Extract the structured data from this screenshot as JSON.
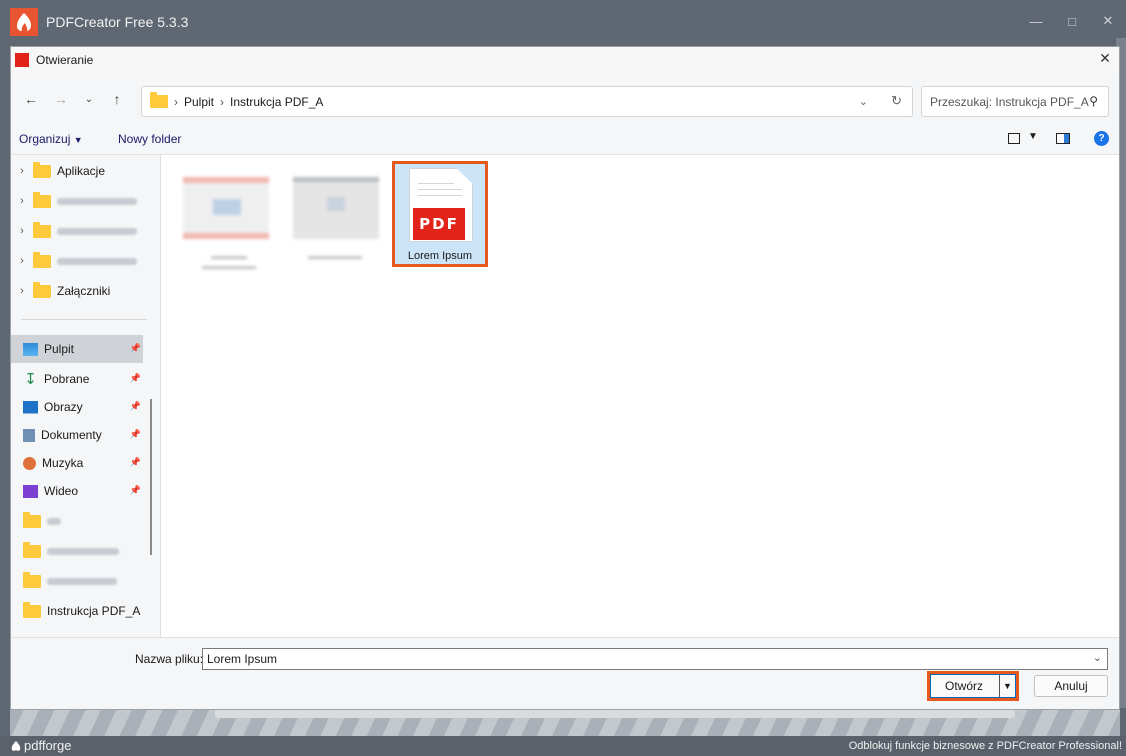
{
  "app": {
    "title": "PDFCreator Free 5.3.3",
    "brand": "pdfforge",
    "promo": "Odblokuj funkcje biznesowe z PDFCreator Professional!"
  },
  "dialog": {
    "title": "Otwieranie",
    "breadcrumb": [
      "Pulpit",
      "Instrukcja PDF_A"
    ],
    "search_placeholder": "Przeszukaj: Instrukcja PDF_A",
    "toolbar": {
      "organize": "Organizuj",
      "new_folder": "Nowy folder"
    }
  },
  "sidebar": {
    "tree": [
      {
        "label": "Aplikacje",
        "blurred": false
      },
      {
        "label": "",
        "blurred": true
      },
      {
        "label": "",
        "blurred": true
      },
      {
        "label": "",
        "blurred": true
      },
      {
        "label": "Załączniki",
        "blurred": false
      }
    ],
    "quick_access": [
      {
        "label": "Pulpit",
        "icon": "desktop-icon",
        "pinned": true,
        "selected": true
      },
      {
        "label": "Pobrane",
        "icon": "download-icon",
        "pinned": true
      },
      {
        "label": "Obrazy",
        "icon": "pictures-icon",
        "pinned": true
      },
      {
        "label": "Dokumenty",
        "icon": "documents-icon",
        "pinned": true
      },
      {
        "label": "Muzyka",
        "icon": "music-icon",
        "pinned": true
      },
      {
        "label": "Wideo",
        "icon": "video-icon",
        "pinned": true
      },
      {
        "label": "",
        "icon": "folder-icon",
        "blurred": true
      },
      {
        "label": "",
        "icon": "folder-icon",
        "blurred": true
      },
      {
        "label": "",
        "icon": "folder-icon",
        "blurred": true
      },
      {
        "label": "Instrukcja PDF_A",
        "icon": "folder-icon"
      }
    ]
  },
  "files": [
    {
      "name": "",
      "blurred": true
    },
    {
      "name": "",
      "blurred": true
    },
    {
      "name": "Lorem Ipsum",
      "type": "PDF",
      "selected": true
    }
  ],
  "bottom": {
    "filename_label": "Nazwa pliku:",
    "filename_value": "Lorem Ipsum",
    "open_label": "Otwórz",
    "cancel_label": "Anuluj"
  },
  "colors": {
    "highlight": "#e55a1c",
    "pdf_red": "#e2231a",
    "selection": "#cce4f7"
  }
}
